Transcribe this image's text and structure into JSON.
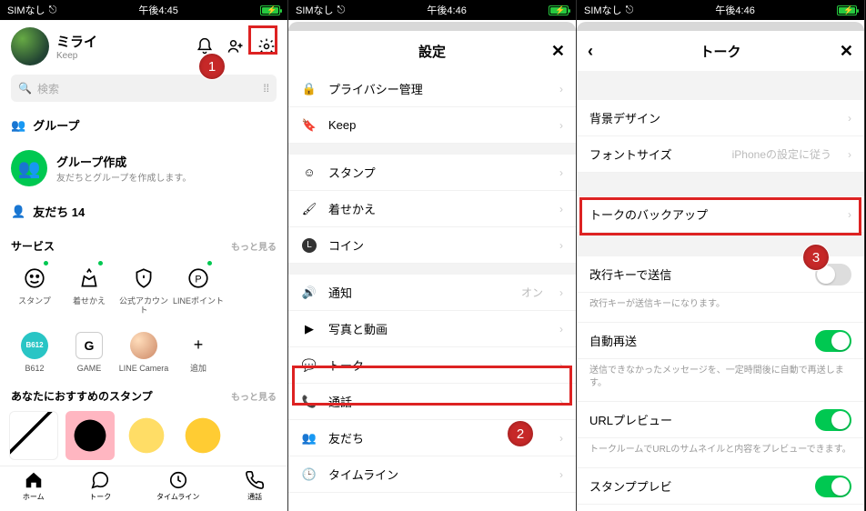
{
  "status": {
    "carrier": "SIMなし",
    "time1": "午後4:45",
    "time2": "午後4:46",
    "time3": "午後4:46"
  },
  "screen1": {
    "profile": {
      "name": "ミライ",
      "keep": "Keep"
    },
    "search_placeholder": "検索",
    "groups_label": "グループ",
    "group_create": {
      "title": "グループ作成",
      "sub": "友だちとグループを作成します。"
    },
    "friends_label": "友だち 14",
    "services_label": "サービス",
    "see_more": "もっと見る",
    "svc": [
      {
        "label": "スタンプ"
      },
      {
        "label": "着せかえ"
      },
      {
        "label": "公式アカウント"
      },
      {
        "label": "LINEポイント"
      },
      {
        "label": ""
      },
      {
        "label": "B612"
      },
      {
        "label": "GAME"
      },
      {
        "label": "LINE Camera"
      },
      {
        "label": "追加"
      }
    ],
    "rec_label": "あなたにおすすめのスタンプ",
    "tabs": [
      {
        "label": "ホーム"
      },
      {
        "label": "トーク"
      },
      {
        "label": "タイムライン"
      },
      {
        "label": "通話"
      }
    ]
  },
  "screen2": {
    "title": "設定",
    "rows": [
      {
        "icon": "lock",
        "label": "プライバシー管理"
      },
      {
        "icon": "bookmark",
        "label": "Keep"
      },
      {
        "icon": "smile",
        "label": "スタンプ"
      },
      {
        "icon": "brush",
        "label": "着せかえ"
      },
      {
        "icon": "coin",
        "label": "コイン"
      },
      {
        "icon": "speaker",
        "label": "通知",
        "meta": "オン"
      },
      {
        "icon": "play",
        "label": "写真と動画"
      },
      {
        "icon": "chat",
        "label": "トーク"
      },
      {
        "icon": "phone",
        "label": "通話"
      },
      {
        "icon": "friends",
        "label": "友だち"
      },
      {
        "icon": "clock",
        "label": "タイムライン"
      }
    ]
  },
  "screen3": {
    "title": "トーク",
    "rows": {
      "bg": "背景デザイン",
      "font": {
        "label": "フォントサイズ",
        "meta": "iPhoneの設定に従う"
      },
      "backup": "トークのバックアップ",
      "enter_send": {
        "label": "改行キーで送信",
        "desc": "改行キーが送信キーになります。"
      },
      "auto_resend": {
        "label": "自動再送",
        "desc": "送信できなかったメッセージを、一定時間後に自動で再送します。"
      },
      "url_preview": {
        "label": "URLプレビュー",
        "desc": "トークルームでURLのサムネイルと内容をプレビューできます。"
      },
      "stamp_preview_partial": "スタンププレビ"
    }
  },
  "annotations": {
    "1": "1",
    "2": "2",
    "3": "3"
  }
}
